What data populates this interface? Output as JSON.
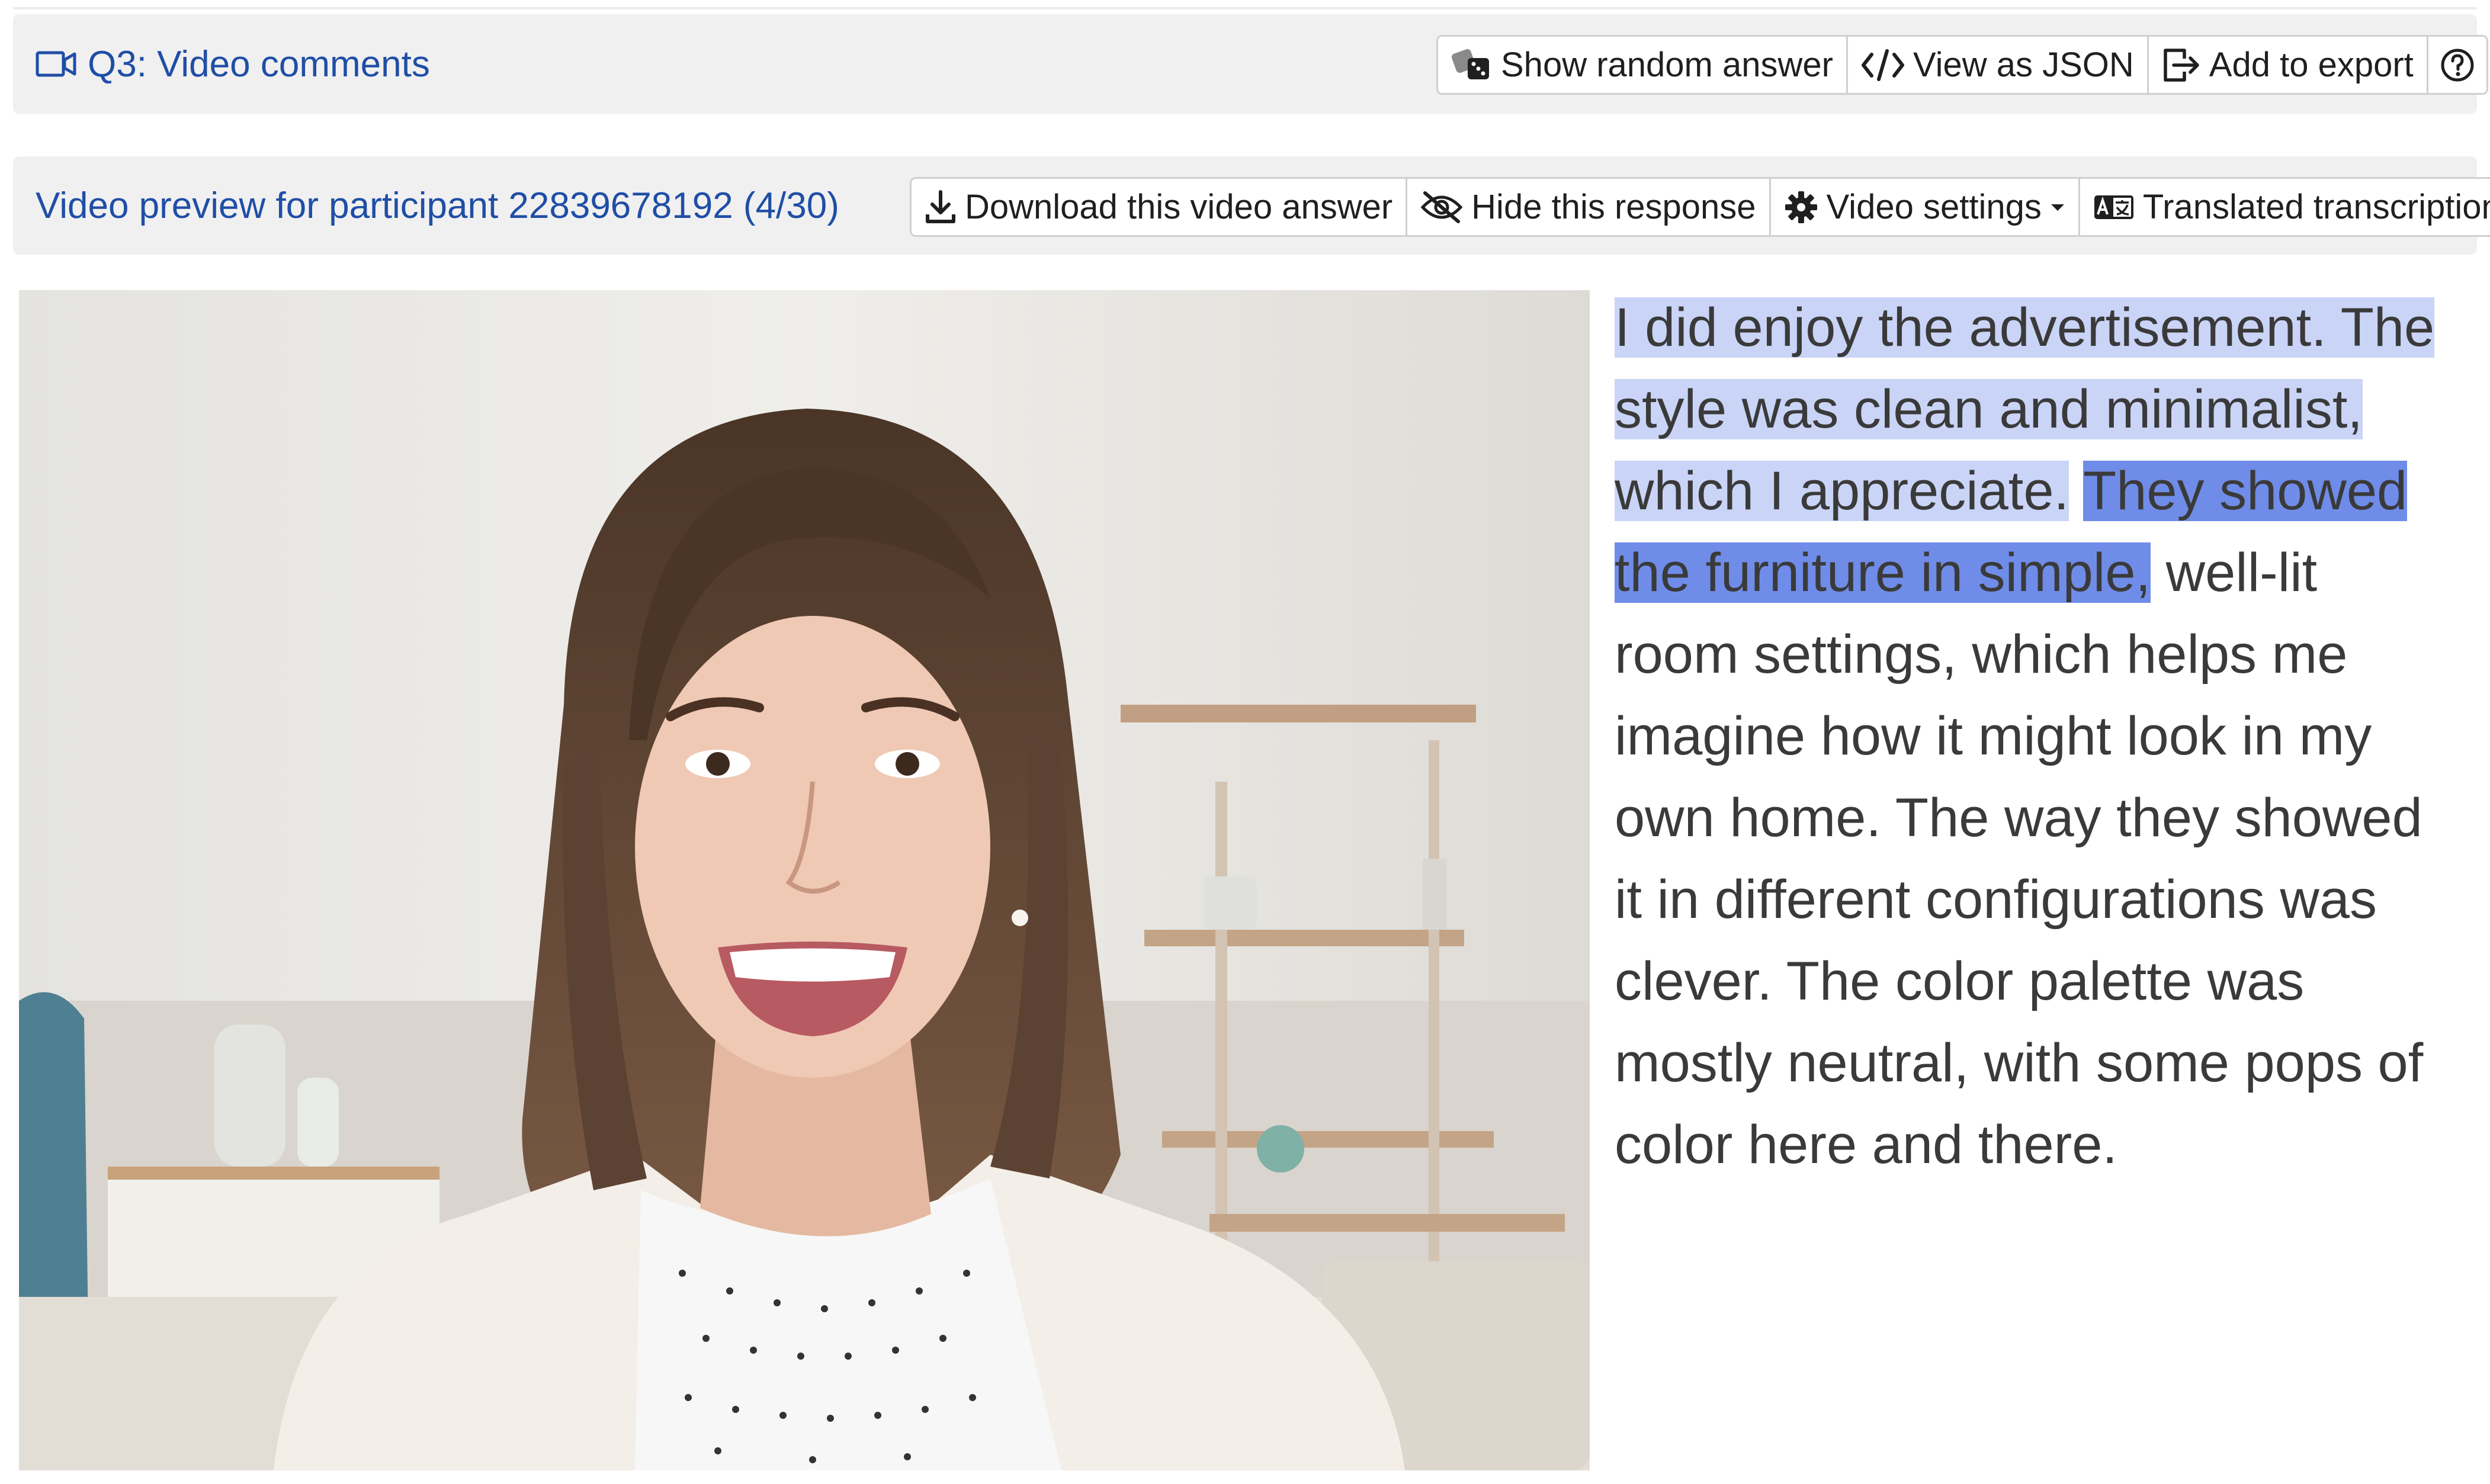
{
  "question": {
    "label": "Q3:",
    "title": "Video comments",
    "icon": "video-camera-icon"
  },
  "toolbar": {
    "show_random": "Show random answer",
    "view_json": "View as JSON",
    "add_export": "Add to export",
    "help_icon": "question-circle-icon"
  },
  "preview": {
    "title": "Video preview for participant 22839678192 (4/30)",
    "download": "Download this video answer",
    "hide": "Hide this response",
    "video_settings": "Video settings",
    "translated": "Translated transcription"
  },
  "transcript": {
    "highlighted_light": "I did enjoy the advertisement. The style was clean and minimalist, which I appreciate.",
    "highlighted_dark": "They showed the furniture in simple,",
    "rest": "well-lit room settings, which helps me imagine how it might look in my own home. The way they showed it in different configurations was clever. The color palette was mostly neutral, with some pops of color here and there."
  },
  "colors": {
    "link_blue": "#1f4ea6",
    "highlight_light": "#c9d4f7",
    "highlight_dark": "#6f8ce8"
  }
}
